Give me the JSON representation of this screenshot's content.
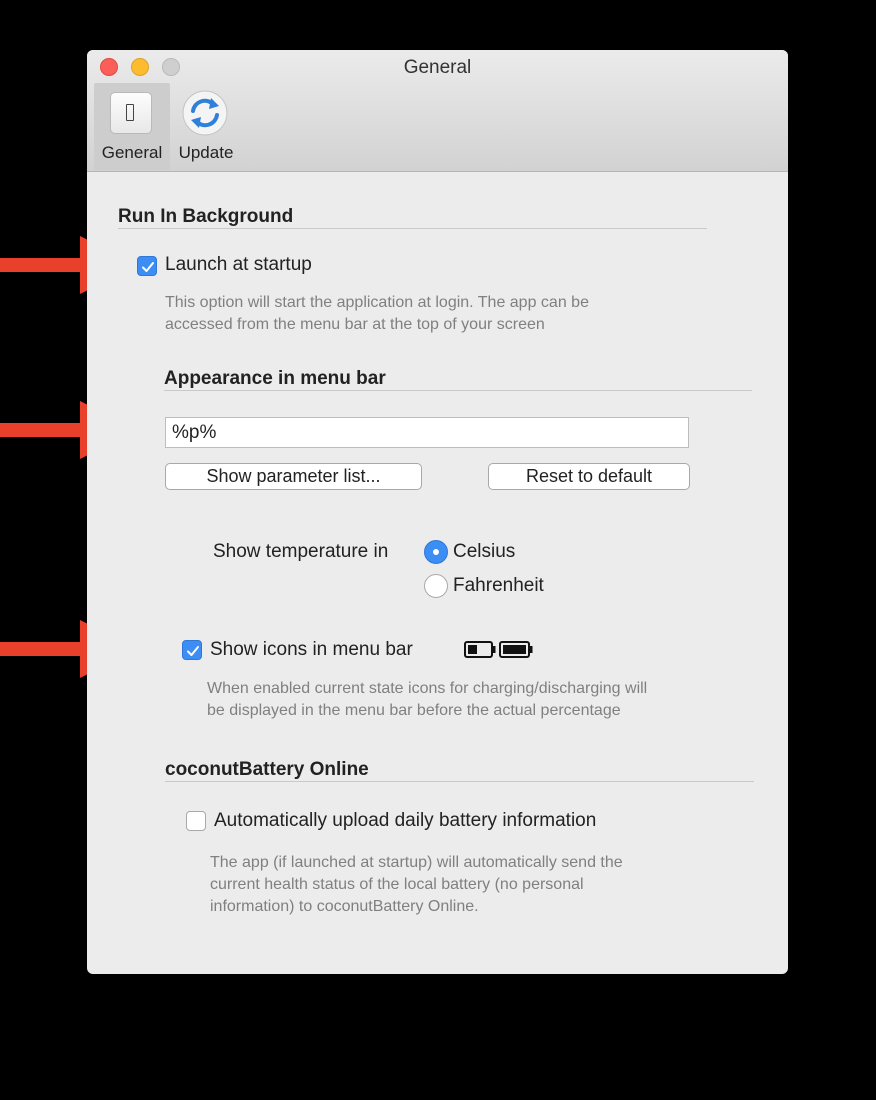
{
  "window": {
    "title": "General"
  },
  "toolbar": {
    "tabs": [
      {
        "label": "General",
        "icon": "switch-icon",
        "selected": true
      },
      {
        "label": "Update",
        "icon": "refresh-icon",
        "selected": false
      }
    ]
  },
  "run_in_background": {
    "title": "Run In Background",
    "launch_label": "Launch at startup",
    "launch_checked": true,
    "description_line1": "This option will start the application at login. The app can be",
    "description_line2": "accessed from the menu bar at the top of your screen"
  },
  "appearance": {
    "title": "Appearance in menu bar",
    "format_value": "%p%",
    "show_params_label": "Show parameter list...",
    "reset_label": "Reset to default",
    "temperature_label": "Show temperature in",
    "celsius_label": "Celsius",
    "fahrenheit_label": "Fahrenheit",
    "selected_unit": "Celsius",
    "show_icons_label": "Show icons in menu bar",
    "show_icons_checked": true,
    "icons_description_line1": "When enabled current state icons for charging/discharging will",
    "icons_description_line2": "be displayed in the menu bar before the actual percentage"
  },
  "online": {
    "title": "coconutBattery Online",
    "upload_label": "Automatically upload daily battery information",
    "upload_checked": false,
    "description_line1": "The app (if launched at startup) will automatically send the",
    "description_line2": "current health status of the local battery (no personal",
    "description_line3": "information) to coconutBattery Online."
  },
  "colors": {
    "accent": "#3c8ef4",
    "annotation_arrow": "#e8402a",
    "window_background": "#ececec"
  }
}
